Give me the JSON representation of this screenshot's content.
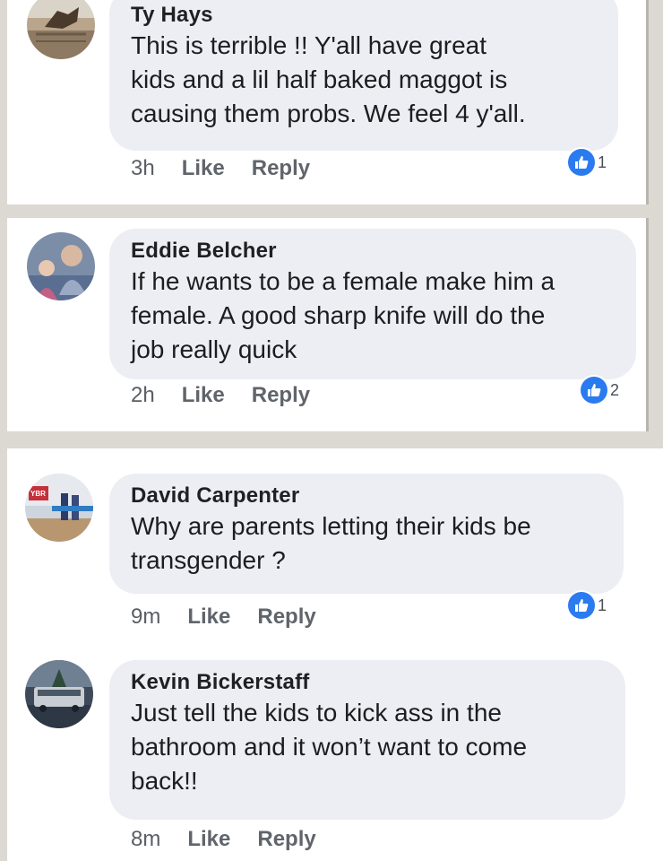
{
  "comments": [
    {
      "author": "Ty Hays",
      "lines": [
        "This is terrible !!    Y'all have great",
        "kids and a lil half baked maggot is",
        "causing them probs.   We feel 4 y'all."
      ],
      "time": "3h",
      "like_label": "Like",
      "reply_label": "Reply",
      "reaction_count": "1",
      "reaction_icon": "thumbs-up-icon",
      "avatar_icon": "rodeo-photo-avatar"
    },
    {
      "author": "Eddie Belcher",
      "lines": [
        "If he wants to be a female make him a",
        "female. A good sharp knife will do the",
        "job really quick"
      ],
      "time": "2h",
      "like_label": "Like",
      "reply_label": "Reply",
      "reaction_count": "2",
      "reaction_icon": "thumbs-up-icon",
      "avatar_icon": "man-with-child-avatar"
    },
    {
      "author": "David Carpenter",
      "lines": [
        "Why are parents letting their kids be",
        "transgender ?"
      ],
      "time": "9m",
      "like_label": "Like",
      "reply_label": "Reply",
      "reaction_count": "1",
      "reaction_icon": "thumbs-up-icon",
      "avatar_icon": "arena-photo-avatar",
      "avatar_sign": "YBR"
    },
    {
      "author": "Kevin Bickerstaff",
      "lines": [
        "Just tell the kids to kick ass in the",
        "bathroom and it won’t want to come",
        "back!!"
      ],
      "time": "8m",
      "like_label": "Like",
      "reply_label": "Reply",
      "avatar_icon": "bus-photo-avatar"
    }
  ],
  "colors": {
    "bubble": "#eceef3",
    "like_blue": "#2b7bf0",
    "meta_gray": "#60646b"
  }
}
